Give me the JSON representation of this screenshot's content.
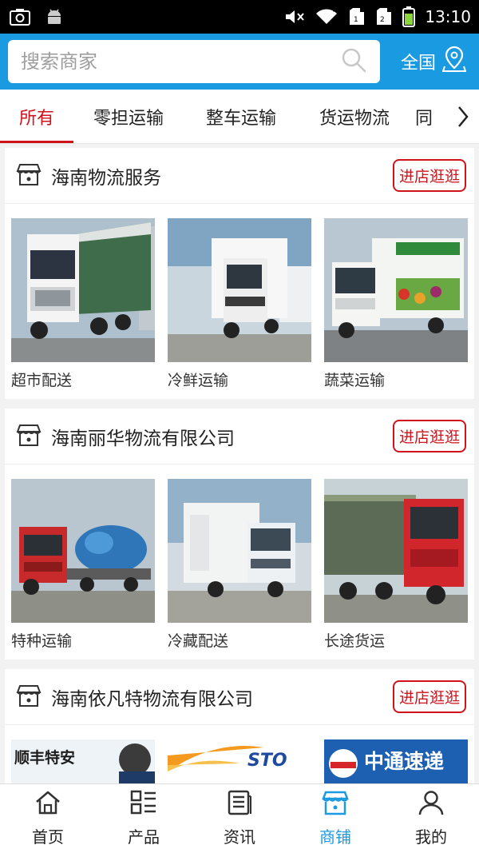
{
  "status_bar": {
    "time": "13:10"
  },
  "search": {
    "placeholder": "搜索商家",
    "region_label": "全国"
  },
  "tabs": [
    {
      "label": "所有",
      "active": true
    },
    {
      "label": "零担运输",
      "active": false
    },
    {
      "label": "整车运输",
      "active": false
    },
    {
      "label": "货运物流",
      "active": false
    },
    {
      "label": "同",
      "active": false
    }
  ],
  "shops": [
    {
      "name": "海南物流服务",
      "enter_label": "进店逛逛",
      "products": [
        {
          "label": "超市配送",
          "image": "white-volvo-truck"
        },
        {
          "label": "冷鲜运输",
          "image": "white-refrigerated-truck"
        },
        {
          "label": "蔬菜运输",
          "image": "vegetable-box-truck"
        }
      ]
    },
    {
      "name": "海南丽华物流有限公司",
      "enter_label": "进店逛逛",
      "products": [
        {
          "label": "特种运输",
          "image": "red-heavy-haul-truck"
        },
        {
          "label": "冷藏配送",
          "image": "small-box-truck"
        },
        {
          "label": "长途货运",
          "image": "red-cargo-truck"
        }
      ]
    },
    {
      "name": "海南依凡特物流有限公司",
      "enter_label": "进店逛逛",
      "products": [
        {
          "label": "",
          "image": "sf-express-banner",
          "banner_text": "顺丰特安"
        },
        {
          "label": "",
          "image": "sto-express-banner",
          "banner_text": "STO"
        },
        {
          "label": "",
          "image": "zto-express-banner",
          "banner_text": "中通速递"
        }
      ]
    }
  ],
  "bottom_nav": [
    {
      "label": "首页",
      "icon": "home-icon",
      "active": false
    },
    {
      "label": "产品",
      "icon": "grid-list-icon",
      "active": false
    },
    {
      "label": "资讯",
      "icon": "news-icon",
      "active": false
    },
    {
      "label": "商铺",
      "icon": "shop-icon",
      "active": true
    },
    {
      "label": "我的",
      "icon": "user-icon",
      "active": false
    }
  ],
  "colors": {
    "header_blue": "#1a9ae0",
    "accent_red": "#d0131b"
  }
}
